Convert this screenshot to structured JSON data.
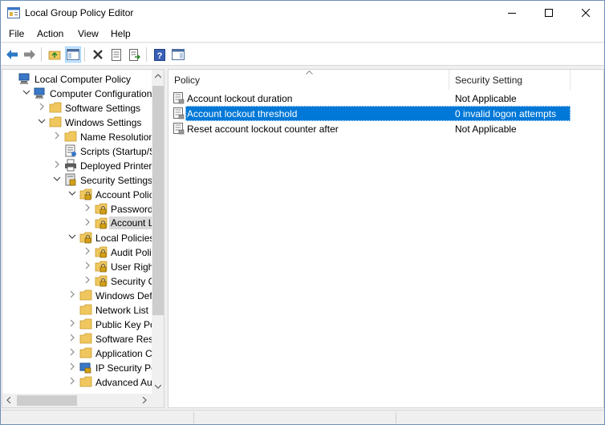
{
  "window": {
    "title": "Local Group Policy Editor"
  },
  "menu": [
    "File",
    "Action",
    "View",
    "Help"
  ],
  "toolbar": {
    "buttons": [
      "back-icon",
      "forward-icon",
      "up-folder-icon",
      "show-hide-tree-icon",
      "delete-icon",
      "properties-icon",
      "export-list-icon",
      "help-icon",
      "show-action-pane-icon"
    ]
  },
  "tree": {
    "items": [
      {
        "label": "Local Computer Policy",
        "expanded": true
      },
      {
        "label": "Computer Configuration",
        "expanded": true
      },
      {
        "label": "Software Settings",
        "expanded": false
      },
      {
        "label": "Windows Settings",
        "expanded": true
      },
      {
        "label": "Name Resolution P",
        "expanded": false
      },
      {
        "label": "Scripts (Startup/Shu",
        "expanded": false
      },
      {
        "label": "Deployed Printers",
        "expanded": false
      },
      {
        "label": "Security Settings",
        "expanded": true
      },
      {
        "label": "Account Policie",
        "expanded": true
      },
      {
        "label": "Password Po",
        "expanded": false
      },
      {
        "label": "Account Loc",
        "expanded": false,
        "selected": true
      },
      {
        "label": "Local Policies",
        "expanded": true
      },
      {
        "label": "Audit Policy",
        "expanded": false
      },
      {
        "label": "User Rights A",
        "expanded": false
      },
      {
        "label": "Security Opt",
        "expanded": false
      },
      {
        "label": "Windows Defen",
        "expanded": false
      },
      {
        "label": "Network List Ma",
        "expanded": false
      },
      {
        "label": "Public Key Polic",
        "expanded": false
      },
      {
        "label": "Software Restric",
        "expanded": false
      },
      {
        "label": "Application Cor",
        "expanded": false
      },
      {
        "label": "IP Security Polic",
        "expanded": false
      },
      {
        "label": "Advanced Audit",
        "expanded": false
      }
    ]
  },
  "list": {
    "columns": [
      "Policy",
      "Security Setting"
    ],
    "rows": [
      {
        "policy": "Account lockout duration",
        "setting": "Not Applicable",
        "selected": false
      },
      {
        "policy": "Account lockout threshold",
        "setting": "0 invalid logon attempts",
        "selected": true
      },
      {
        "policy": "Reset account lockout counter after",
        "setting": "Not Applicable",
        "selected": false
      }
    ]
  },
  "colors": {
    "selection": "#0078d7",
    "folder": "#f0c75e"
  }
}
